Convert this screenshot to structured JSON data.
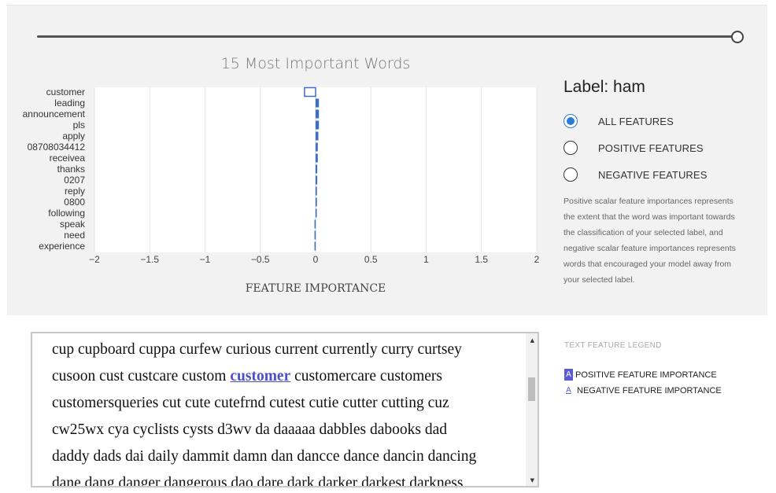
{
  "chart_data": {
    "type": "bar",
    "orientation": "horizontal",
    "title": "15 Most Important Words",
    "xlabel": "FEATURE IMPORTANCE",
    "ylabel": "",
    "xlim": [
      -2,
      2
    ],
    "xticks": [
      "−2",
      "−1.5",
      "−1",
      "−0.5",
      "0",
      "0.5",
      "1",
      "1.5",
      "2"
    ],
    "categories": [
      "customer",
      "leading",
      "announcement",
      "pls",
      "apply",
      "08708034412",
      "receivea",
      "thanks",
      "0207",
      "reply",
      "0800",
      "following",
      "speak",
      "need",
      "experience"
    ],
    "values": [
      -0.1,
      0.03,
      0.03,
      0.03,
      0.025,
      0.02,
      0.02,
      0.015,
      0.015,
      0.012,
      0.012,
      0.01,
      -0.01,
      -0.01,
      -0.01
    ],
    "highlighted": "customer",
    "bar_color": "#3a6ec9",
    "grid": true
  },
  "label_panel": {
    "title": "Label: ham",
    "options": [
      {
        "label": "ALL FEATURES",
        "checked": true
      },
      {
        "label": "POSITIVE FEATURES",
        "checked": false
      },
      {
        "label": "NEGATIVE FEATURES",
        "checked": false
      }
    ],
    "description": "Positive scalar feature importances represents the extent that the word was important towards the classification of your selected label, and negative scalar feature importances represents words that encouraged your model away from your selected label."
  },
  "text_view": {
    "lines": [
      [
        {
          "t": "cup cupboard cuppa curfew curious current currently curry curtsey"
        }
      ],
      [
        {
          "t": "cusoon cust custcare custom "
        },
        {
          "t": "customer",
          "hl": true
        },
        {
          "t": " customercare customers"
        }
      ],
      [
        {
          "t": "customersqueries cut cute cutefrnd cutest cutie cutter cutting cuz"
        }
      ],
      [
        {
          "t": "cw25wx cya cyclists cysts d3wv da daaaaa dabbles dabooks dad"
        }
      ],
      [
        {
          "t": "daddy dads dai daily dammit damn dan dancce dance dancin dancing"
        }
      ],
      [
        {
          "t": "dane dang danger dangerous dao dare dark darker darkest darkness"
        }
      ]
    ]
  },
  "legend": {
    "title": "TEXT FEATURE LEGEND",
    "positive_swatch": "A",
    "positive_label": "POSITIVE FEATURE IMPORTANCE",
    "negative_swatch": "A",
    "negative_label": "NEGATIVE FEATURE IMPORTANCE",
    "accent": "#5b5bd6"
  },
  "scroll_up_glyph": "▲",
  "scroll_down_glyph": "▼"
}
